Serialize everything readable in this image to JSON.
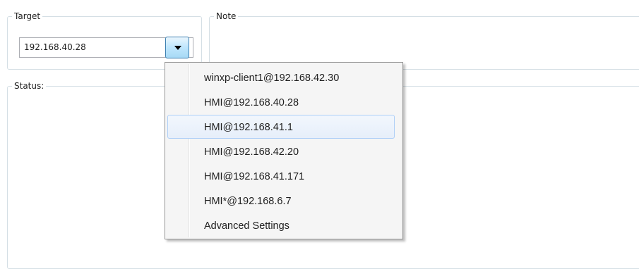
{
  "target": {
    "legend": "Target",
    "combo_value": "192.168.40.28",
    "dropdown_items": [
      "winxp-client1@192.168.42.30",
      "HMI@192.168.40.28",
      "HMI@192.168.41.1",
      "HMI@192.168.42.20",
      "HMI@192.168.41.171",
      "HMI*@192.168.6.7",
      "Advanced Settings"
    ],
    "highlighted_index": 2
  },
  "note": {
    "legend": "Note"
  },
  "status": {
    "legend": "Status:"
  },
  "icons": {
    "dropdown_arrow": "chevron-down-icon"
  }
}
